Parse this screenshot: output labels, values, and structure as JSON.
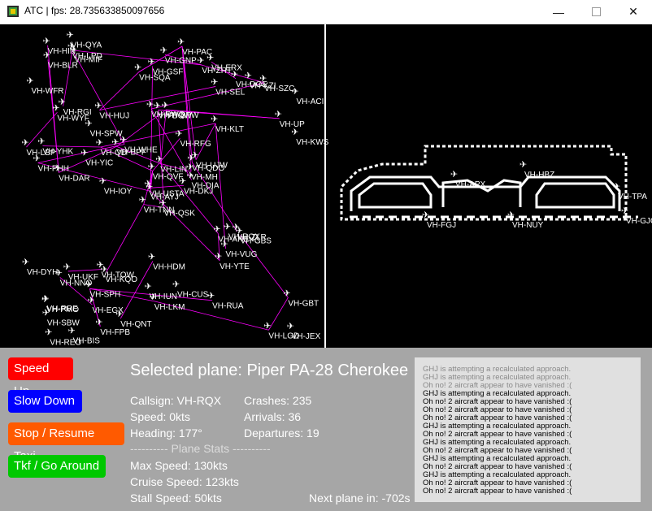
{
  "window": {
    "title": "ATC | fps: 28.735633850097656",
    "minimize_icon": "minimize-icon",
    "maximize_icon": "maximize-icon",
    "close_icon": "close-icon"
  },
  "radar_labels": [
    "VH-QSK",
    "VH-WYF",
    "VH-AYJ",
    "VH-RRE",
    "VH-QDO",
    "VH-KQO",
    "VH-ERX",
    "VH-BPW",
    "VH-SEL",
    "VH-DKJ",
    "VH-MIF",
    "VH-JEX",
    "VH-DAR",
    "VH-ACI",
    "VH-TNN",
    "VH-KLT",
    "VH-BIS",
    "VH-RWQ",
    "VH-RFG",
    "VH-UKF",
    "VH-WHE",
    "VH-SBW",
    "VH-EGX",
    "VH-BOW",
    "VH-UJW",
    "VH-GBS",
    "VH-RGI",
    "VH-GSF",
    "VH-PHH",
    "VH-ANE",
    "VH-KWS",
    "VH-USTA",
    "VH-IUN",
    "VH-QVF",
    "VH-HUJ",
    "VH-DOE",
    "VH-TOW",
    "VH-LGD",
    "VH-GBT",
    "VH-ZLR",
    "VH-PAC",
    "VH-BPF",
    "VH-YIC",
    "VH-YTE",
    "VH-FPB",
    "VH-LBP",
    "VH-MH",
    "VH-REO",
    "VH-LKM",
    "VH-DIA",
    "VH-NNO",
    "VH-UP",
    "VH-WFR",
    "VH-VUG",
    "VH-RUA",
    "VH-SPH",
    "VH-LPD",
    "VH-HIN",
    "VH-CUS",
    "VH-SZC",
    "VH-GNP",
    "VH-IOY",
    "VH-YHK",
    "VH-SPW",
    "VH-KZI",
    "VH-QYA",
    "VH-ZHT",
    "VH-SQA",
    "VH-LIN",
    "VH-DYH",
    "VH-HDM",
    "VH-QNT",
    "VH-RQX",
    "VH-QD",
    "VH-PMO",
    "VH-BLR",
    "VH-APX",
    "VH-HBZ",
    "VH-TPA",
    "VH-FGJ",
    "VH-NUY",
    "VH-GJO"
  ],
  "buttons": {
    "speed_up": "Speed Up",
    "slow_down": "Slow Down",
    "stop_resume_taxi": "Stop / Resume Taxi",
    "takeoff_go_around": "Tkf / Go Around"
  },
  "selected": {
    "title": "Selected plane: Piper PA-28 Cherokee",
    "callsign": "Callsign: VH-RQX",
    "speed": "Speed: 0kts",
    "heading": "Heading: 177°",
    "stats_divider": "---------- Plane Stats ----------",
    "max_speed": "Max Speed: 130kts",
    "cruise_speed": "Cruise Speed: 123kts",
    "stall_speed": "Stall Speed: 50kts"
  },
  "counters": {
    "crashes": "Crashes: 235",
    "arrivals": "Arrivals: 36",
    "departures": "Departures: 19",
    "next_plane": "Next plane in: -702s"
  },
  "log": [
    {
      "text": "GHJ is attempting a recalculated approach.",
      "dim": true
    },
    {
      "text": "GHJ is attempting a recalculated approach.",
      "dim": true
    },
    {
      "text": "Oh no! 2 aircraft appear to have vanished :(",
      "dim": true
    },
    {
      "text": "GHJ is attempting a recalculated approach.",
      "dim": false
    },
    {
      "text": "Oh no! 2 aircraft appear to have vanished :(",
      "dim": false
    },
    {
      "text": "Oh no! 2 aircraft appear to have vanished :(",
      "dim": false
    },
    {
      "text": "Oh no! 2 aircraft appear to have vanished :(",
      "dim": false
    },
    {
      "text": "GHJ is attempting a recalculated approach.",
      "dim": false
    },
    {
      "text": "Oh no! 2 aircraft appear to have vanished :(",
      "dim": false
    },
    {
      "text": "GHJ is attempting a recalculated approach.",
      "dim": false
    },
    {
      "text": "Oh no! 2 aircraft appear to have vanished :(",
      "dim": false
    },
    {
      "text": "GHJ is attempting a recalculated approach.",
      "dim": false
    },
    {
      "text": "Oh no! 2 aircraft appear to have vanished :(",
      "dim": false
    },
    {
      "text": "GHJ is attempting a recalculated approach.",
      "dim": false
    },
    {
      "text": "Oh no! 2 aircraft appear to have vanished :(",
      "dim": false
    },
    {
      "text": "Oh no! 2 aircraft appear to have vanished :(",
      "dim": false
    }
  ]
}
